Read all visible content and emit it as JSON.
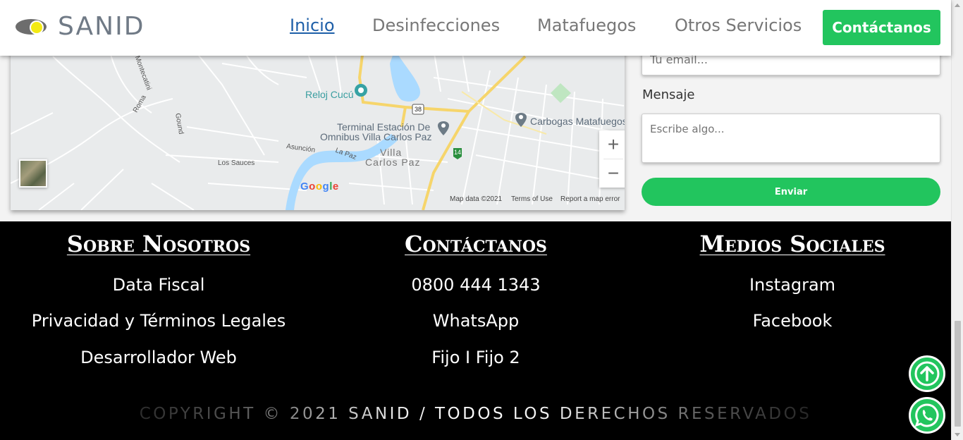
{
  "header": {
    "brand": "SANID",
    "nav": [
      {
        "label": "Inicio",
        "active": true
      },
      {
        "label": "Desinfecciones",
        "active": false
      },
      {
        "label": "Matafuegos",
        "active": false
      },
      {
        "label": "Otros Servicios",
        "active": false
      }
    ],
    "cta_label": "Contáctanos"
  },
  "map": {
    "labels": {
      "reloj": "Reloj Cucú",
      "terminal_1": "Terminal Estación De",
      "terminal_2": "Omnibus Villa Carlos Paz",
      "carbogas": "Carbogas Matafuegos",
      "villa": "Villa",
      "carlos_paz": "Carlos Paz",
      "los_sauces": "Los Sauces",
      "asuncion": "Asunción",
      "la_paz": "La Paz",
      "roma": "Roma",
      "gound": "Gound",
      "montecatini": "Montecatini",
      "route_38": "38",
      "route_14": "14"
    },
    "zoom_in": "+",
    "zoom_out": "−",
    "google": [
      "G",
      "o",
      "o",
      "g",
      "l",
      "e"
    ],
    "footer": {
      "data": "Map data ©2021",
      "terms": "Terms of Use",
      "report": "Report a map error"
    }
  },
  "form": {
    "email_placeholder": "Tu email...",
    "message_label": "Mensaje",
    "message_placeholder": "Escribe algo...",
    "submit_label": "Enviar"
  },
  "footer": {
    "columns": [
      {
        "title": "Sobre Nosotros",
        "links": [
          "Data Fiscal",
          "Privacidad y Términos Legales",
          "Desarrollador Web"
        ]
      },
      {
        "title": "Contáctanos",
        "links": [
          "0800 444 1343",
          "WhatsApp",
          "Fijo I Fijo 2"
        ]
      },
      {
        "title": "Medios Sociales",
        "links": [
          "Instagram",
          "Facebook"
        ]
      }
    ],
    "copyright": "COPYRIGHT © 2021 SANID / TODOS LOS DERECHOS RESERVADOS"
  },
  "colors": {
    "accent_green": "#22c55e",
    "nav_active": "#1e5fa8",
    "footer_bg": "#000000"
  },
  "icons": {
    "scroll_top": "arrow-up-circle-icon",
    "whatsapp": "whatsapp-icon"
  }
}
